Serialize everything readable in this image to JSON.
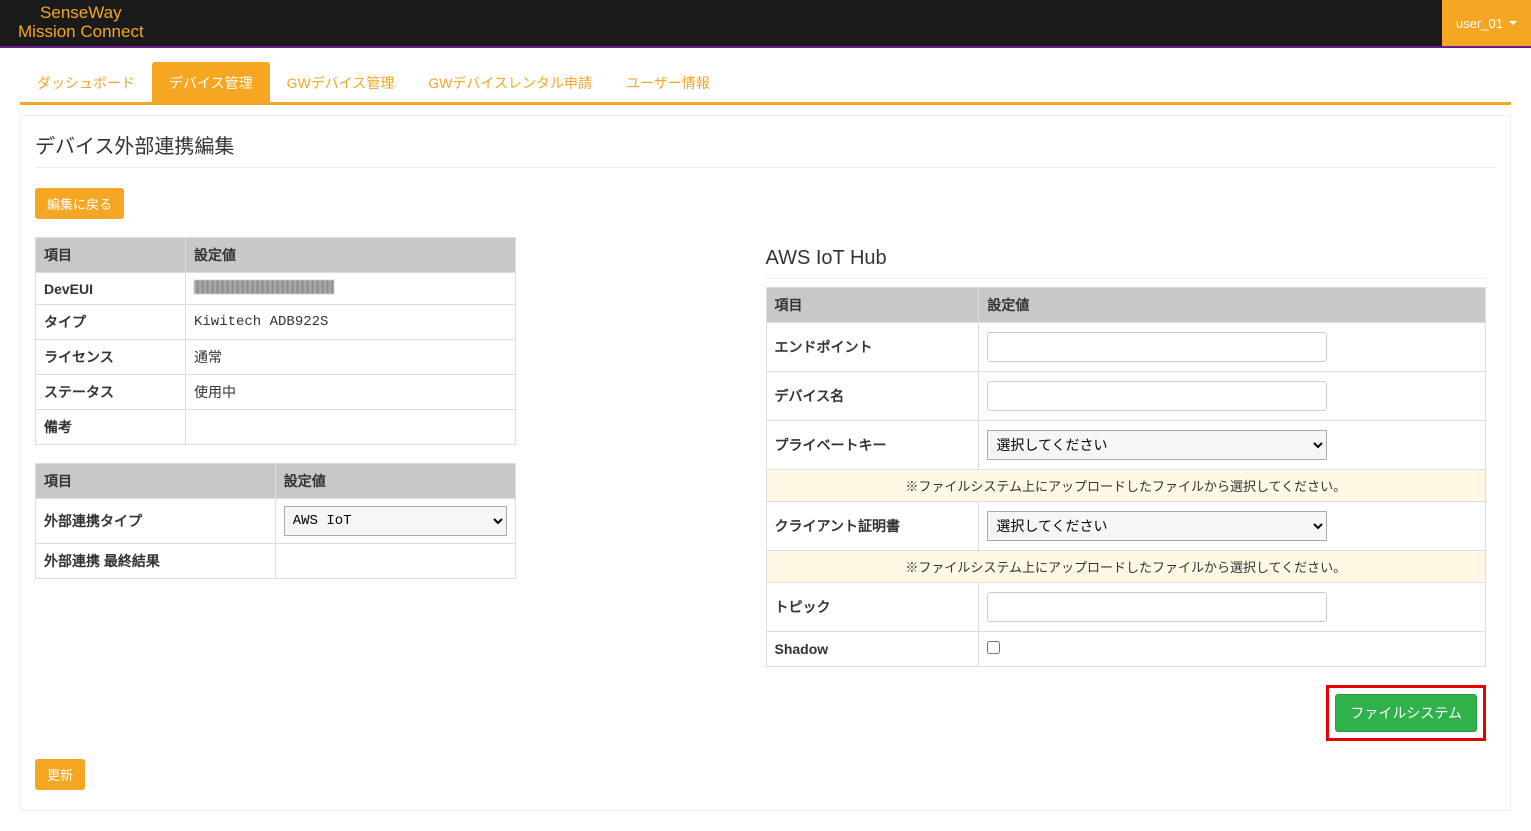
{
  "header": {
    "logo_line1": "SenseWay",
    "logo_line2": "Mission Connect",
    "user_label": "user_01"
  },
  "tabs": [
    {
      "label": "ダッシュボード",
      "active": false
    },
    {
      "label": "デバイス管理",
      "active": true
    },
    {
      "label": "GWデバイス管理",
      "active": false
    },
    {
      "label": "GWデバイスレンタル申請",
      "active": false
    },
    {
      "label": "ユーザー情報",
      "active": false
    }
  ],
  "page_title": "デバイス外部連携編集",
  "back_button": "編集に戻る",
  "left_table1": {
    "head_item": "項目",
    "head_value": "設定値",
    "rows": {
      "deveui_label": "DevEUI",
      "type_label": "タイプ",
      "type_value": "Kiwitech ADB922S",
      "license_label": "ライセンス",
      "license_value": "通常",
      "status_label": "ステータス",
      "status_value": "使用中",
      "note_label": "備考",
      "note_value": ""
    }
  },
  "left_table2": {
    "head_item": "項目",
    "head_value": "設定値",
    "ext_type_label": "外部連携タイプ",
    "ext_type_value": "AWS IoT",
    "ext_result_label": "外部連携 最終結果",
    "ext_result_value": ""
  },
  "right": {
    "heading": "AWS IoT Hub",
    "head_item": "項目",
    "head_value": "設定値",
    "endpoint_label": "エンドポイント",
    "devicename_label": "デバイス名",
    "privkey_label": "プライベートキー",
    "select_placeholder": "選択してください",
    "upload_note": "※ファイルシステム上にアップロードしたファイルから選択してください。",
    "clientcert_label": "クライアント証明書",
    "topic_label": "トピック",
    "shadow_label": "Shadow"
  },
  "filesystem_button": "ファイルシステム",
  "update_button": "更新"
}
